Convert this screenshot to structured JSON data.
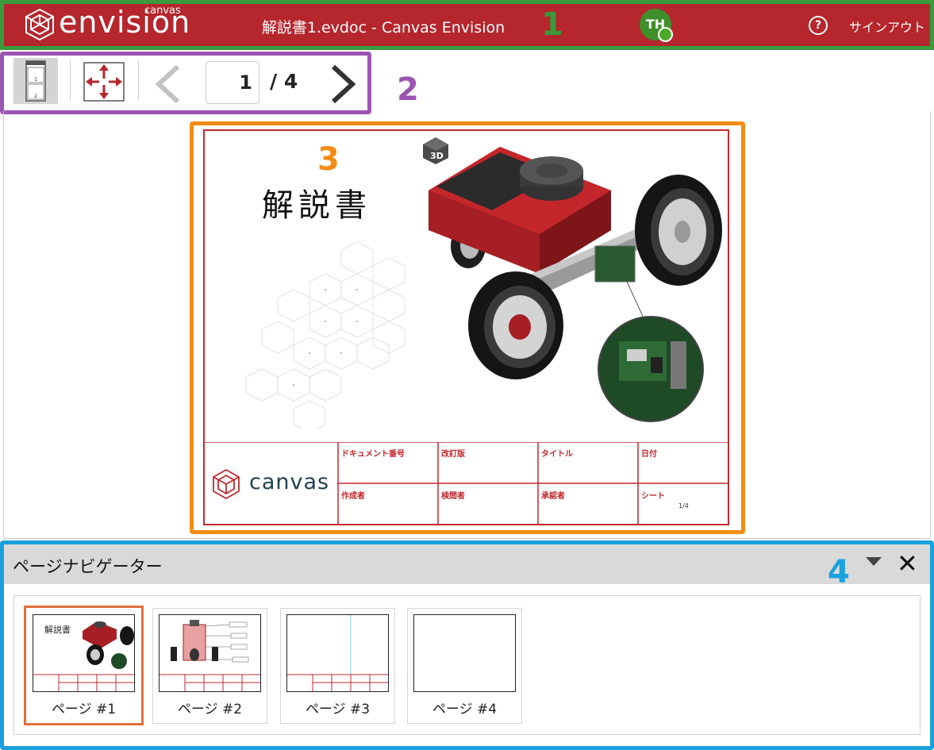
{
  "header": {
    "logo_text": "envision",
    "logo_sub": "canvas",
    "doc_title": "解説書1.evdoc - Canvas Envision",
    "avatar_initials": "TH",
    "help_symbol": "?",
    "signout_label": "サインアウト"
  },
  "toolbar": {
    "page_current": "1",
    "page_total": "/ 4",
    "thumb_pages": [
      "1",
      "2"
    ]
  },
  "sheet": {
    "title": "解説書",
    "badge": "3D",
    "company": "canvas",
    "title_block": {
      "row1": [
        "ドキュメント番号",
        "改訂版",
        "タイトル",
        "日付"
      ],
      "row2": [
        "作成者",
        "検閲者",
        "承認者",
        "シート"
      ],
      "sheet_value": "1/4"
    }
  },
  "navigator": {
    "title": "ページナビゲーター",
    "close_symbol": "✕",
    "thumbnails": [
      {
        "label": "ページ #1"
      },
      {
        "label": "ページ #2"
      },
      {
        "label": "ページ #3"
      },
      {
        "label": "ページ #4"
      }
    ]
  },
  "markers": [
    "1",
    "2",
    "3",
    "4"
  ],
  "colors": {
    "brand_red": "#b5262d",
    "marker_green": "#3a9a3c",
    "marker_purple": "#9b55b0",
    "marker_orange": "#f28c14",
    "marker_blue": "#1aa1dd",
    "selected_thumb": "#e0703a"
  }
}
